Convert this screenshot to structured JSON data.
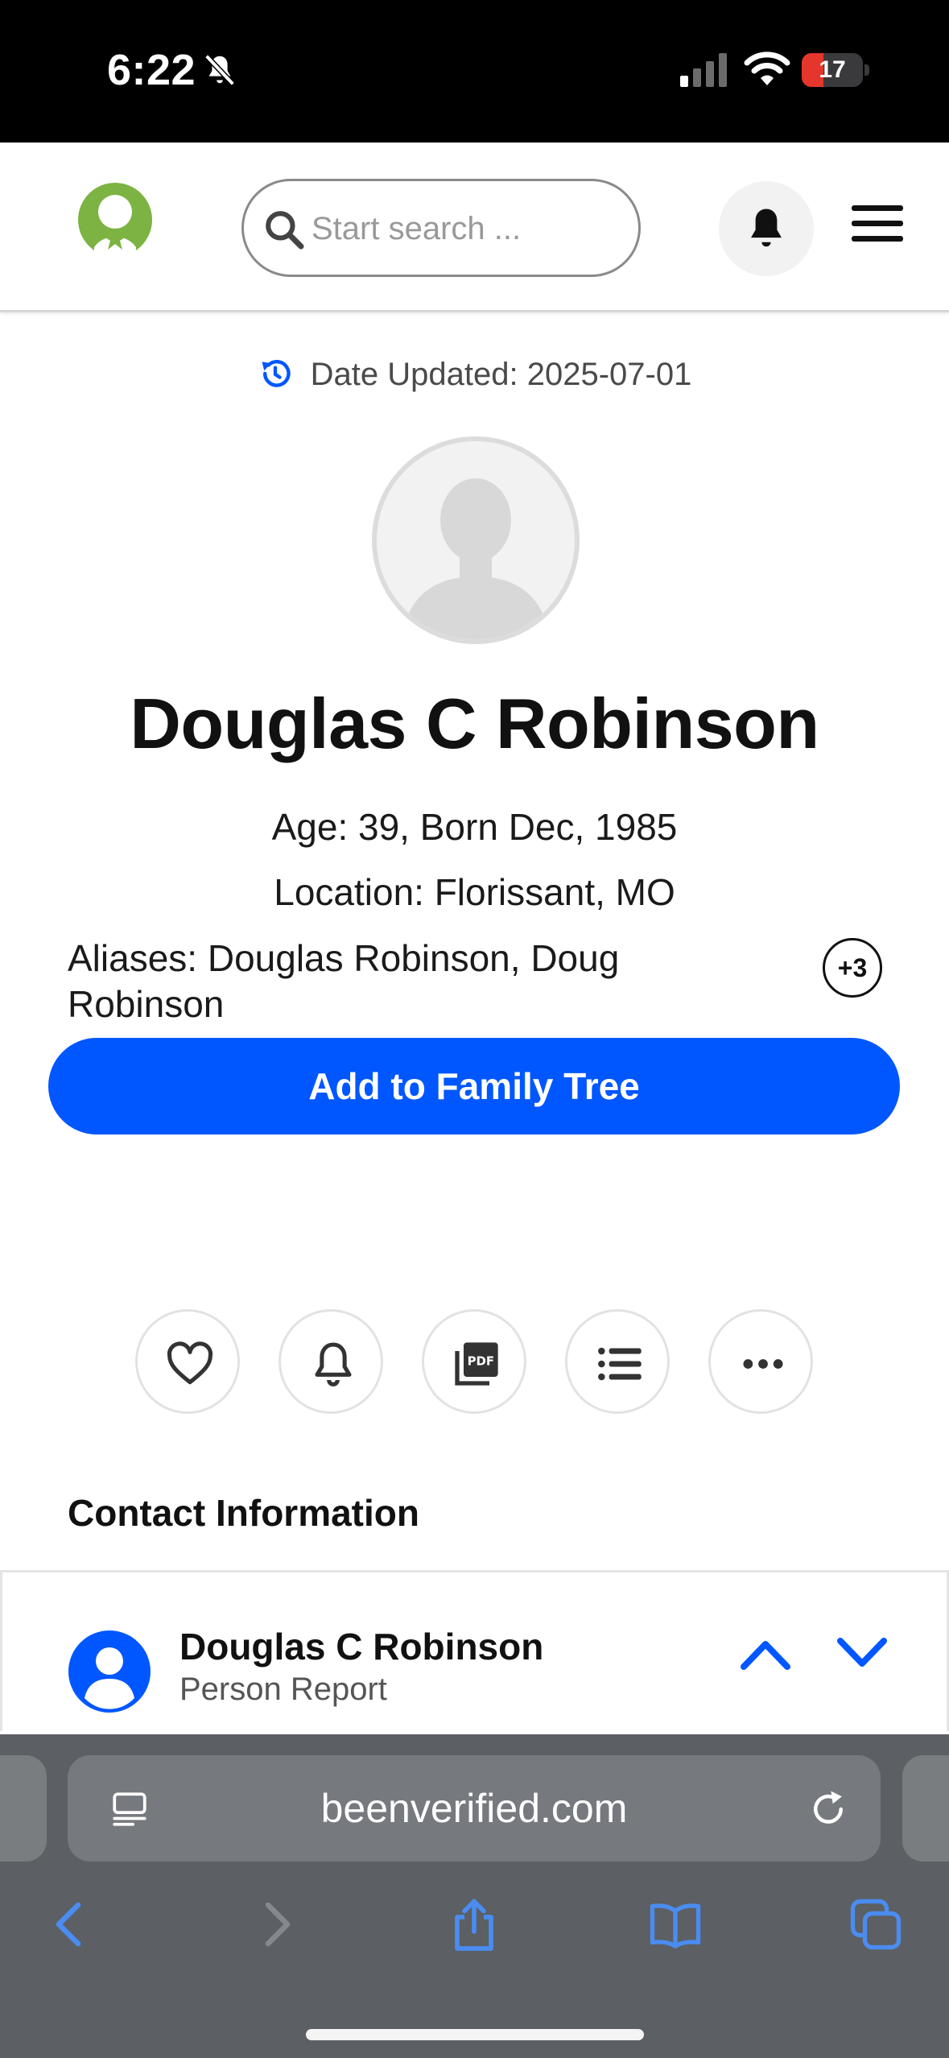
{
  "status_bar": {
    "time": "6:22",
    "battery_level": "17",
    "battery_fraction": 0.17,
    "icons": [
      "bell-slash-icon",
      "cellular-signal-icon",
      "wifi-icon",
      "battery-icon"
    ]
  },
  "header": {
    "logo_icon": "beenverified-logo",
    "search_placeholder": "Start search ...",
    "notifications_icon": "bell-icon",
    "menu_icon": "hamburger-menu-icon"
  },
  "profile": {
    "date_updated": "Date Updated: 2025-07-01",
    "name": "Douglas C Robinson",
    "age_line": "Age: 39, Born Dec, 1985",
    "location_line": "Location: Florissant, MO",
    "aliases": "Aliases: Douglas Robinson, Doug Robinson",
    "aliases_more": "+3",
    "add_family_tree_label": "Add to Family Tree"
  },
  "actions": [
    {
      "icon": "heart-icon"
    },
    {
      "icon": "bell-icon"
    },
    {
      "icon": "pdf-icon"
    },
    {
      "icon": "list-icon"
    },
    {
      "icon": "more-icon"
    }
  ],
  "contact_section": {
    "title": "Contact Information",
    "report_name": "Douglas C Robinson",
    "report_type": "Person Report"
  },
  "browser": {
    "url": "beenverified.com",
    "nav_icons": [
      "back-icon",
      "forward-icon",
      "share-icon",
      "bookmarks-icon",
      "tabs-icon"
    ]
  },
  "colors": {
    "primary_blue": "#0057ff",
    "logo_green": "#7cb342",
    "status_bar": "#000000",
    "browser_chrome": "#5c5f63",
    "browser_icon_blue": "#4a8cf0",
    "battery_red": "#e5362c"
  }
}
